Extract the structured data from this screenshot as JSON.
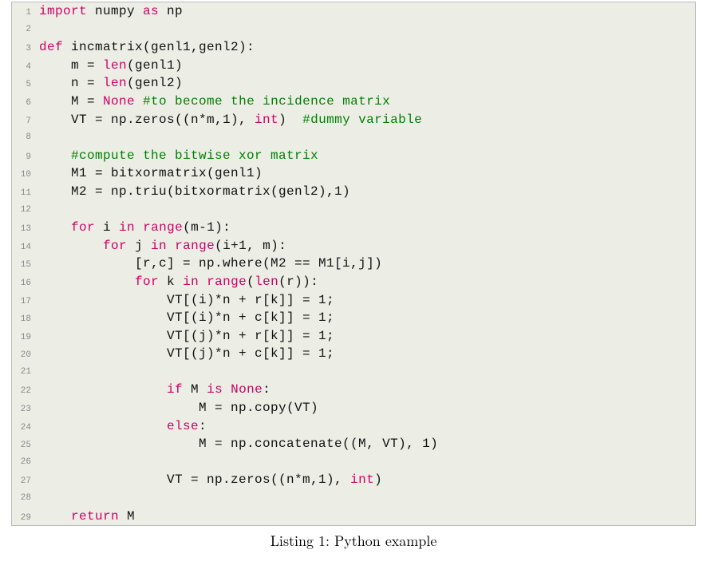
{
  "caption": "Listing 1: Python example",
  "lines": [
    {
      "num": "1",
      "tokens": [
        {
          "c": "kw",
          "t": "import"
        },
        {
          "c": "txt",
          "t": " numpy "
        },
        {
          "c": "kw",
          "t": "as"
        },
        {
          "c": "txt",
          "t": " np"
        }
      ]
    },
    {
      "num": "2",
      "tokens": [
        {
          "c": "txt",
          "t": ""
        }
      ]
    },
    {
      "num": "3",
      "tokens": [
        {
          "c": "kw",
          "t": "def"
        },
        {
          "c": "txt",
          "t": " incmatrix(genl1,genl2):"
        }
      ]
    },
    {
      "num": "4",
      "tokens": [
        {
          "c": "txt",
          "t": "    m = "
        },
        {
          "c": "bi",
          "t": "len"
        },
        {
          "c": "txt",
          "t": "(genl1)"
        }
      ]
    },
    {
      "num": "5",
      "tokens": [
        {
          "c": "txt",
          "t": "    n = "
        },
        {
          "c": "bi",
          "t": "len"
        },
        {
          "c": "txt",
          "t": "(genl2)"
        }
      ]
    },
    {
      "num": "6",
      "tokens": [
        {
          "c": "txt",
          "t": "    M = "
        },
        {
          "c": "bi",
          "t": "None"
        },
        {
          "c": "txt",
          "t": " "
        },
        {
          "c": "cmt",
          "t": "#to become the incidence matrix"
        }
      ]
    },
    {
      "num": "7",
      "tokens": [
        {
          "c": "txt",
          "t": "    VT = np.zeros((n*m,1), "
        },
        {
          "c": "bi",
          "t": "int"
        },
        {
          "c": "txt",
          "t": ")  "
        },
        {
          "c": "cmt",
          "t": "#dummy variable"
        }
      ]
    },
    {
      "num": "8",
      "tokens": [
        {
          "c": "txt",
          "t": ""
        }
      ]
    },
    {
      "num": "9",
      "tokens": [
        {
          "c": "txt",
          "t": "    "
        },
        {
          "c": "cmt",
          "t": "#compute the bitwise xor matrix"
        }
      ]
    },
    {
      "num": "10",
      "tokens": [
        {
          "c": "txt",
          "t": "    M1 = bitxormatrix(genl1)"
        }
      ]
    },
    {
      "num": "11",
      "tokens": [
        {
          "c": "txt",
          "t": "    M2 = np.triu(bitxormatrix(genl2),1)"
        }
      ]
    },
    {
      "num": "12",
      "tokens": [
        {
          "c": "txt",
          "t": ""
        }
      ]
    },
    {
      "num": "13",
      "tokens": [
        {
          "c": "txt",
          "t": "    "
        },
        {
          "c": "kw",
          "t": "for"
        },
        {
          "c": "txt",
          "t": " i "
        },
        {
          "c": "kw",
          "t": "in"
        },
        {
          "c": "txt",
          "t": " "
        },
        {
          "c": "bi",
          "t": "range"
        },
        {
          "c": "txt",
          "t": "(m-1):"
        }
      ]
    },
    {
      "num": "14",
      "tokens": [
        {
          "c": "txt",
          "t": "        "
        },
        {
          "c": "kw",
          "t": "for"
        },
        {
          "c": "txt",
          "t": " j "
        },
        {
          "c": "kw",
          "t": "in"
        },
        {
          "c": "txt",
          "t": " "
        },
        {
          "c": "bi",
          "t": "range"
        },
        {
          "c": "txt",
          "t": "(i+1, m):"
        }
      ]
    },
    {
      "num": "15",
      "tokens": [
        {
          "c": "txt",
          "t": "            [r,c] = np.where(M2 == M1[i,j])"
        }
      ]
    },
    {
      "num": "16",
      "tokens": [
        {
          "c": "txt",
          "t": "            "
        },
        {
          "c": "kw",
          "t": "for"
        },
        {
          "c": "txt",
          "t": " k "
        },
        {
          "c": "kw",
          "t": "in"
        },
        {
          "c": "txt",
          "t": " "
        },
        {
          "c": "bi",
          "t": "range"
        },
        {
          "c": "txt",
          "t": "("
        },
        {
          "c": "bi",
          "t": "len"
        },
        {
          "c": "txt",
          "t": "(r)):"
        }
      ]
    },
    {
      "num": "17",
      "tokens": [
        {
          "c": "txt",
          "t": "                VT[(i)*n + r[k]] = 1;"
        }
      ]
    },
    {
      "num": "18",
      "tokens": [
        {
          "c": "txt",
          "t": "                VT[(i)*n + c[k]] = 1;"
        }
      ]
    },
    {
      "num": "19",
      "tokens": [
        {
          "c": "txt",
          "t": "                VT[(j)*n + r[k]] = 1;"
        }
      ]
    },
    {
      "num": "20",
      "tokens": [
        {
          "c": "txt",
          "t": "                VT[(j)*n + c[k]] = 1;"
        }
      ]
    },
    {
      "num": "21",
      "tokens": [
        {
          "c": "txt",
          "t": ""
        }
      ]
    },
    {
      "num": "22",
      "tokens": [
        {
          "c": "txt",
          "t": "                "
        },
        {
          "c": "kw",
          "t": "if"
        },
        {
          "c": "txt",
          "t": " M "
        },
        {
          "c": "kw",
          "t": "is"
        },
        {
          "c": "txt",
          "t": " "
        },
        {
          "c": "bi",
          "t": "None"
        },
        {
          "c": "txt",
          "t": ":"
        }
      ]
    },
    {
      "num": "23",
      "tokens": [
        {
          "c": "txt",
          "t": "                    M = np.copy(VT)"
        }
      ]
    },
    {
      "num": "24",
      "tokens": [
        {
          "c": "txt",
          "t": "                "
        },
        {
          "c": "kw",
          "t": "else"
        },
        {
          "c": "txt",
          "t": ":"
        }
      ]
    },
    {
      "num": "25",
      "tokens": [
        {
          "c": "txt",
          "t": "                    M = np.concatenate((M, VT), 1)"
        }
      ]
    },
    {
      "num": "26",
      "tokens": [
        {
          "c": "txt",
          "t": ""
        }
      ]
    },
    {
      "num": "27",
      "tokens": [
        {
          "c": "txt",
          "t": "                VT = np.zeros((n*m,1), "
        },
        {
          "c": "bi",
          "t": "int"
        },
        {
          "c": "txt",
          "t": ")"
        }
      ]
    },
    {
      "num": "28",
      "tokens": [
        {
          "c": "txt",
          "t": ""
        }
      ]
    },
    {
      "num": "29",
      "tokens": [
        {
          "c": "txt",
          "t": "    "
        },
        {
          "c": "kw",
          "t": "return"
        },
        {
          "c": "txt",
          "t": " M"
        }
      ]
    }
  ]
}
